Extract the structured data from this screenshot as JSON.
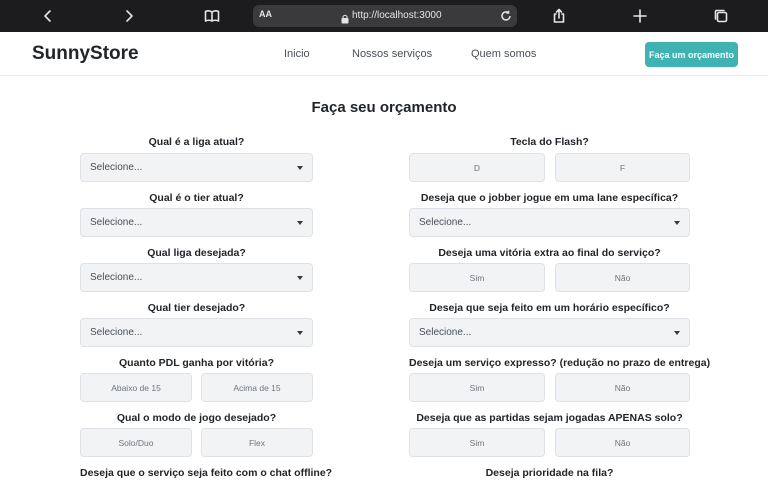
{
  "browser": {
    "text_size_label": "AA",
    "url": "http://localhost:3000"
  },
  "navbar": {
    "brand": "SunnyStore",
    "links": [
      "Inicio",
      "Nossos serviços",
      "Quem somos"
    ],
    "cta_label": "Faça um orçamento",
    "accent_color": "#3fb2b2"
  },
  "form": {
    "title": "Faça seu orçamento",
    "left": {
      "q1": {
        "label": "Qual é a liga atual?",
        "value": "Selecione..."
      },
      "q2": {
        "label": "Qual é o tier atual?",
        "value": "Selecione..."
      },
      "q3": {
        "label": "Qual liga desejada?",
        "value": "Selecione..."
      },
      "q4": {
        "label": "Qual tier desejado?",
        "value": "Selecione..."
      },
      "q5": {
        "label": "Quanto PDL ganha por vitória?",
        "options": [
          "Abaixo de 15",
          "Acima de 15"
        ]
      },
      "q6": {
        "label": "Qual o modo de jogo desejado?",
        "options": [
          "Solo/Duo",
          "Flex"
        ]
      },
      "q7": {
        "label": "Deseja que o serviço seja feito com o chat offline?"
      }
    },
    "right": {
      "q1": {
        "label": "Tecla do Flash?",
        "options": [
          "D",
          "F"
        ]
      },
      "q2": {
        "label": "Deseja que o jobber jogue em uma lane específica?",
        "value": "Selecione..."
      },
      "q3": {
        "label": "Deseja uma vitória extra ao final do serviço?",
        "options": [
          "Sim",
          "Não"
        ]
      },
      "q4": {
        "label": "Deseja que seja feito em um horário específico?",
        "value": "Selecione..."
      },
      "q5": {
        "label": "Deseja um serviço expresso? (redução no prazo de entrega)",
        "options": [
          "Sim",
          "Não"
        ]
      },
      "q6": {
        "label": "Deseja que as partidas sejam jogadas APENAS solo?",
        "options": [
          "Sim",
          "Não"
        ]
      },
      "q7": {
        "label": "Deseja prioridade na fila?"
      }
    }
  }
}
